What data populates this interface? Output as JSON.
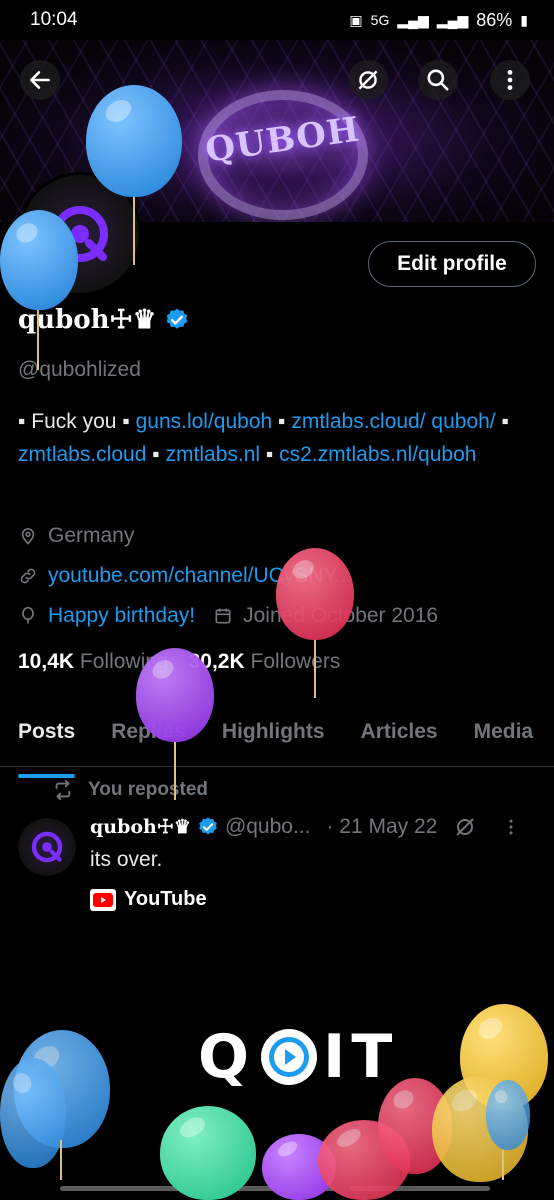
{
  "status_bar": {
    "time": "10:04",
    "network": "5G",
    "battery": "86%"
  },
  "banner": {
    "logo_text": "QUBOH"
  },
  "profile": {
    "display_name": "quboh☩♛",
    "handle": "@qubohlized",
    "edit_label": "Edit profile",
    "bio": {
      "t1": "▪ Fuck you ▪ ",
      "l1": "guns.lol/quboh",
      "t2": " ▪ ",
      "l2": "zmtlabs.cloud/ quboh/",
      "t3": " ▪ ",
      "l3": "zmtlabs.cloud",
      "t4": " ▪ ",
      "l4": "zmtlabs.nl",
      "t5": " ▪ ",
      "l5": "cs2.zmtlabs.nl/quboh"
    },
    "location": "Germany",
    "website": "youtube.com/channel/UCySNY...",
    "birthday": "Happy birthday!",
    "joined": "Joined October 2016",
    "following_count": "10,4K",
    "following_label": "Following",
    "followers_count": "30,2K",
    "followers_label": "Followers"
  },
  "tabs": [
    "Posts",
    "Replies",
    "Highlights",
    "Articles",
    "Media"
  ],
  "post": {
    "repost_label": "You reposted",
    "author": "quboh☩♛",
    "handle": "@qubo...",
    "date": "· 21 May 22",
    "text": "its over.",
    "embed_label": "YouTube"
  },
  "overlay": {
    "quit_left": "Q",
    "quit_right": "IT"
  },
  "colors": {
    "accent": "#1d9bf0",
    "background": "#000000",
    "muted": "#71767b"
  }
}
